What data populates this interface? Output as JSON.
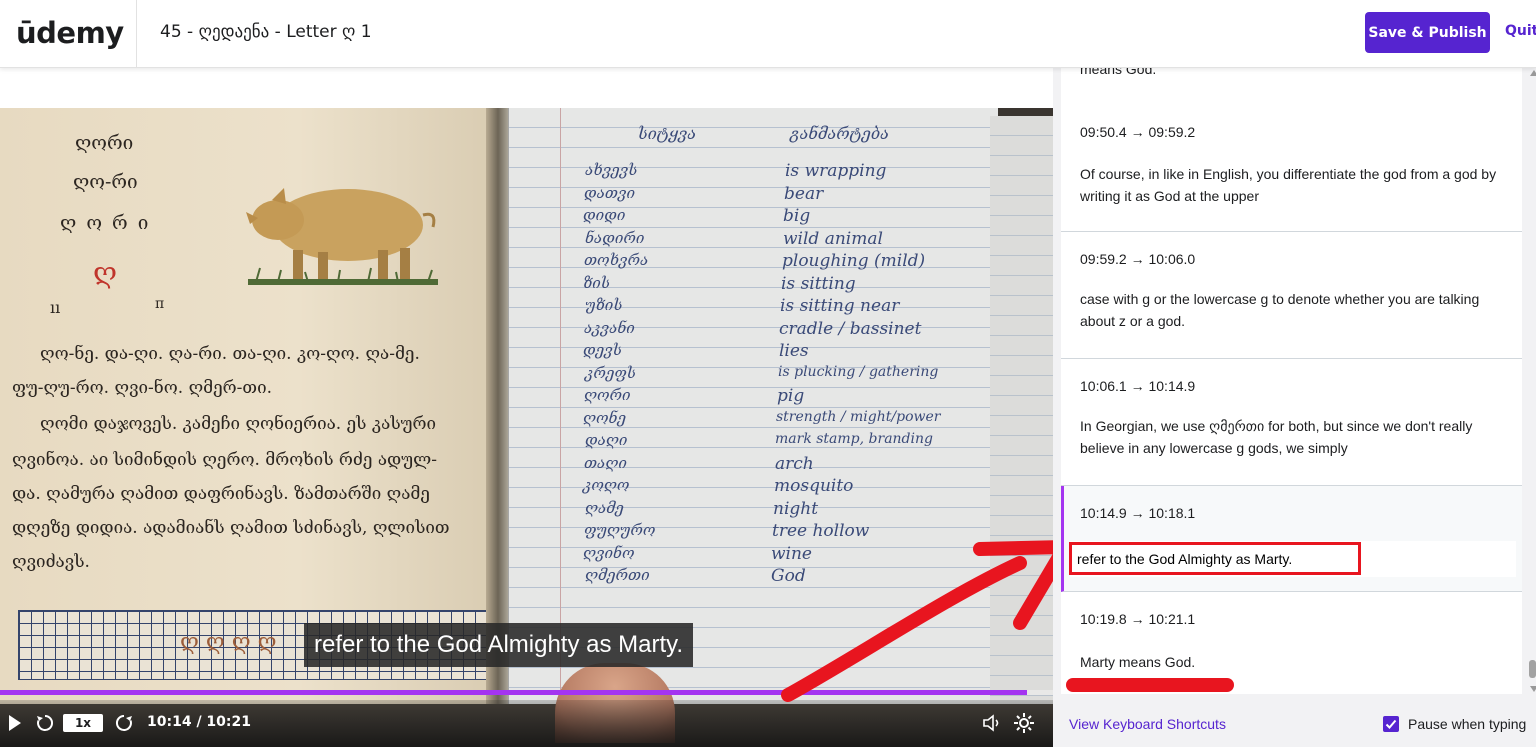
{
  "header": {
    "logo_text": "ūdemy",
    "lecture_title": "45 - ღედაენა - Letter ღ 1",
    "save_label": "Save & Publish",
    "quit_label": "Quit"
  },
  "video": {
    "book_left": {
      "title_lines": [
        "ღორი",
        "ღო-რი",
        "ღ ო რ ი"
      ],
      "big_letter": "ღ",
      "small_marks": [
        "ıı",
        "π"
      ],
      "text_lines": [
        "ღო-ნე. და-ღი. ღა-რი. თა-ღი. კო-ღო. ღა-მე.",
        "ფუ-ღუ-რო. ღვი-ნო. ღმერ-თი.",
        "ღომი დაჯოვეს. კამეჩი ღონიერია. ეს კასური",
        "ღვინოა. აი სიმინდის ღერო. მროხის რძე ადულ-",
        "და. ღამურა ღამით დაფრინავს. ზამთარში ღამე",
        "დღეზე დიდია. ადამიანს ღამით სძინავს, ღლისით",
        "ღვიძავს."
      ],
      "grid_letters": "ღ ღ ღ ღ"
    },
    "notebook": {
      "header_left": "სიტყვა",
      "header_right": "განმარტება",
      "words": [
        "ახვევს",
        "დათვი",
        "დიდი",
        "ნადირი",
        "თოხვრა",
        "ზის",
        "უზის",
        "აკვანი",
        "დევს",
        "კრეფს",
        "ღორი",
        "ღონე",
        "დაღი",
        "თაღი",
        "კოღო",
        "ღამე",
        "ფუღურო",
        "ღვინო",
        "ღმერთი"
      ],
      "meanings": [
        "is wrapping",
        "bear",
        "big",
        "wild animal",
        "ploughing (mild)",
        "is sitting",
        "is sitting near",
        "cradle / bassinet",
        "lies",
        "is plucking / gathering",
        "pig",
        "strength / might/power",
        "mark stamp, branding",
        "arch",
        "mosquito",
        "night",
        "tree hollow",
        "wine",
        "God"
      ]
    },
    "caption": "refer to the God Almighty as Marty.",
    "controls": {
      "speed": "1x",
      "time": "10:14 / 10:21",
      "progress": 0.975
    }
  },
  "transcript": {
    "cues": [
      {
        "time": "",
        "text": "means God."
      },
      {
        "time": "09:50.4 → 09:59.2",
        "text": "Of course, in like in English, you differentiate the god from a god by writing it as God at the upper"
      },
      {
        "time": "09:59.2 → 10:06.0",
        "text": "case with g or the lowercase g to denote whether you are talking about z or a god."
      },
      {
        "time": "10:06.1 → 10:14.9",
        "text": "In Georgian, we use ღმერთი for both, but since we don't really believe in any lowercase g gods, we simply"
      },
      {
        "time": "10:14.9 → 10:18.1",
        "text": "refer to the God Almighty as Marty."
      },
      {
        "time": "10:19.8 → 10:21.1",
        "text": "Marty means God."
      }
    ],
    "active_index": 4
  },
  "footer": {
    "shortcuts_label": "View Keyboard Shortcuts",
    "pause_label": "Pause when typing",
    "pause_checked": true
  },
  "colors": {
    "brand": "#5624d0",
    "progress": "#a435f0",
    "annotation_red": "#e8151f"
  }
}
